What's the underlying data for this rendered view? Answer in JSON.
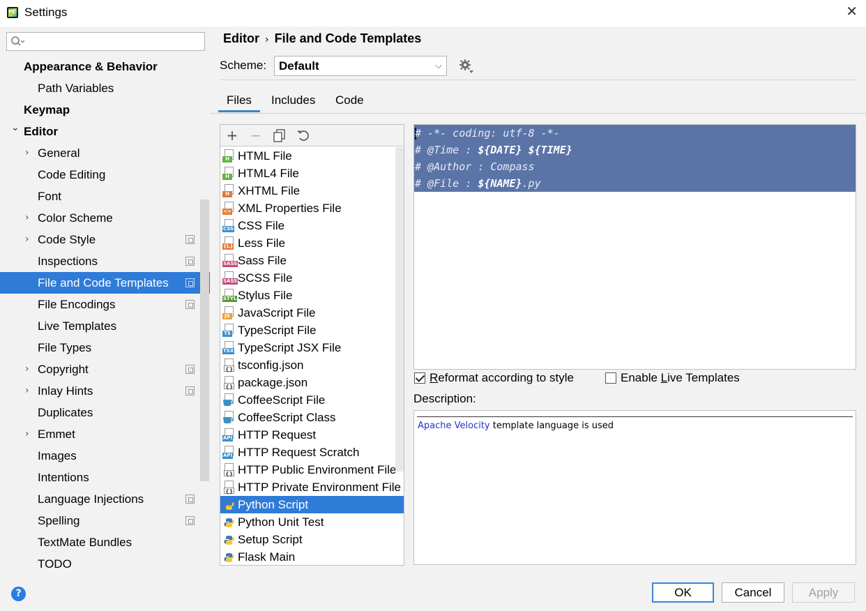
{
  "window": {
    "title": "Settings",
    "close_glyph": "✕"
  },
  "search": {
    "placeholder": "",
    "value": ""
  },
  "sidebar": {
    "items": [
      {
        "label": "Appearance & Behavior",
        "level": 0,
        "bold": true,
        "chevron": "none",
        "project_icon": false,
        "selected": false
      },
      {
        "label": "Path Variables",
        "level": 1,
        "bold": false,
        "chevron": "none",
        "project_icon": false,
        "selected": false
      },
      {
        "label": "Keymap",
        "level": 0,
        "bold": true,
        "chevron": "none",
        "project_icon": false,
        "selected": false
      },
      {
        "label": "Editor",
        "level": 0,
        "bold": true,
        "chevron": "expanded",
        "project_icon": false,
        "selected": false
      },
      {
        "label": "General",
        "level": 1,
        "bold": false,
        "chevron": "collapsed",
        "project_icon": false,
        "selected": false
      },
      {
        "label": "Code Editing",
        "level": 1,
        "bold": false,
        "chevron": "none",
        "project_icon": false,
        "selected": false
      },
      {
        "label": "Font",
        "level": 1,
        "bold": false,
        "chevron": "none",
        "project_icon": false,
        "selected": false
      },
      {
        "label": "Color Scheme",
        "level": 1,
        "bold": false,
        "chevron": "collapsed",
        "project_icon": false,
        "selected": false
      },
      {
        "label": "Code Style",
        "level": 1,
        "bold": false,
        "chevron": "collapsed",
        "project_icon": true,
        "selected": false
      },
      {
        "label": "Inspections",
        "level": 1,
        "bold": false,
        "chevron": "none",
        "project_icon": true,
        "selected": false
      },
      {
        "label": "File and Code Templates",
        "level": 1,
        "bold": false,
        "chevron": "none",
        "project_icon": true,
        "selected": true
      },
      {
        "label": "File Encodings",
        "level": 1,
        "bold": false,
        "chevron": "none",
        "project_icon": true,
        "selected": false
      },
      {
        "label": "Live Templates",
        "level": 1,
        "bold": false,
        "chevron": "none",
        "project_icon": false,
        "selected": false
      },
      {
        "label": "File Types",
        "level": 1,
        "bold": false,
        "chevron": "none",
        "project_icon": false,
        "selected": false
      },
      {
        "label": "Copyright",
        "level": 1,
        "bold": false,
        "chevron": "collapsed",
        "project_icon": true,
        "selected": false
      },
      {
        "label": "Inlay Hints",
        "level": 1,
        "bold": false,
        "chevron": "collapsed",
        "project_icon": true,
        "selected": false
      },
      {
        "label": "Duplicates",
        "level": 1,
        "bold": false,
        "chevron": "none",
        "project_icon": false,
        "selected": false
      },
      {
        "label": "Emmet",
        "level": 1,
        "bold": false,
        "chevron": "collapsed",
        "project_icon": false,
        "selected": false
      },
      {
        "label": "Images",
        "level": 1,
        "bold": false,
        "chevron": "none",
        "project_icon": false,
        "selected": false
      },
      {
        "label": "Intentions",
        "level": 1,
        "bold": false,
        "chevron": "none",
        "project_icon": false,
        "selected": false
      },
      {
        "label": "Language Injections",
        "level": 1,
        "bold": false,
        "chevron": "none",
        "project_icon": true,
        "selected": false
      },
      {
        "label": "Spelling",
        "level": 1,
        "bold": false,
        "chevron": "none",
        "project_icon": true,
        "selected": false
      },
      {
        "label": "TextMate Bundles",
        "level": 1,
        "bold": false,
        "chevron": "none",
        "project_icon": false,
        "selected": false
      },
      {
        "label": "TODO",
        "level": 1,
        "bold": false,
        "chevron": "none",
        "project_icon": false,
        "selected": false
      }
    ]
  },
  "breadcrumb": {
    "parent": "Editor",
    "separator": "›",
    "current": "File and Code Templates"
  },
  "scheme": {
    "label": "Scheme:",
    "value": "Default",
    "dropdown_glyph": "⌵"
  },
  "tabs": [
    {
      "label": "Files",
      "active": true
    },
    {
      "label": "Includes",
      "active": false
    },
    {
      "label": "Code",
      "active": false
    }
  ],
  "toolbar": {
    "add": "+",
    "remove": "−",
    "copy_icon": "copy-icon",
    "reset_icon": "reset-icon"
  },
  "templates": [
    {
      "label": "HTML File",
      "tag": "H",
      "tag_color": "#62b543",
      "kind": "page",
      "selected": false
    },
    {
      "label": "HTML4 File",
      "tag": "H",
      "tag_color": "#62b543",
      "kind": "page",
      "selected": false
    },
    {
      "label": "XHTML File",
      "tag": "H",
      "tag_color": "#e57a3c",
      "kind": "page",
      "selected": false
    },
    {
      "label": "XML Properties File",
      "tag": "<>",
      "tag_color": "#e57a3c",
      "kind": "page",
      "selected": false
    },
    {
      "label": "CSS File",
      "tag": "CSS",
      "tag_color": "#3d8fc6",
      "kind": "page",
      "selected": false
    },
    {
      "label": "Less File",
      "tag": "{L}",
      "tag_color": "#e57a3c",
      "kind": "page",
      "selected": false
    },
    {
      "label": "Sass File",
      "tag": "SASS",
      "tag_color": "#c44a7a",
      "kind": "page",
      "selected": false
    },
    {
      "label": "SCSS File",
      "tag": "SASS",
      "tag_color": "#c44a7a",
      "kind": "page",
      "selected": false
    },
    {
      "label": "Stylus File",
      "tag": "STYL",
      "tag_color": "#5a9a3a",
      "kind": "page",
      "selected": false
    },
    {
      "label": "JavaScript File",
      "tag": "JS",
      "tag_color": "#e8a33a",
      "kind": "page",
      "selected": false
    },
    {
      "label": "TypeScript File",
      "tag": "TS",
      "tag_color": "#3d8fc6",
      "kind": "page",
      "selected": false
    },
    {
      "label": "TypeScript JSX File",
      "tag": "TSX",
      "tag_color": "#3d8fc6",
      "kind": "page",
      "selected": false
    },
    {
      "label": "tsconfig.json",
      "tag": "{}",
      "tag_color": "#6e6e6e",
      "kind": "json",
      "selected": false
    },
    {
      "label": "package.json",
      "tag": "{}",
      "tag_color": "#6e6e6e",
      "kind": "json",
      "selected": false
    },
    {
      "label": "CoffeeScript File",
      "tag": "",
      "tag_color": "#3d8fc6",
      "kind": "coffee",
      "selected": false
    },
    {
      "label": "CoffeeScript Class",
      "tag": "",
      "tag_color": "#3d8fc6",
      "kind": "coffee",
      "selected": false
    },
    {
      "label": "HTTP Request",
      "tag": "API",
      "tag_color": "#3d8fc6",
      "kind": "page",
      "selected": false
    },
    {
      "label": "HTTP Request Scratch",
      "tag": "API",
      "tag_color": "#3d8fc6",
      "kind": "page",
      "selected": false
    },
    {
      "label": "HTTP Public Environment File",
      "tag": "{}",
      "tag_color": "#6e6e6e",
      "kind": "json",
      "selected": false
    },
    {
      "label": "HTTP Private Environment File",
      "tag": "{}",
      "tag_color": "#6e6e6e",
      "kind": "json",
      "selected": false
    },
    {
      "label": "Python Script",
      "tag": "",
      "tag_color": "#3d79b5",
      "kind": "python",
      "selected": true
    },
    {
      "label": "Python Unit Test",
      "tag": "",
      "tag_color": "#3d79b5",
      "kind": "python",
      "selected": false
    },
    {
      "label": "Setup Script",
      "tag": "",
      "tag_color": "#3d79b5",
      "kind": "python",
      "selected": false
    },
    {
      "label": "Flask Main",
      "tag": "",
      "tag_color": "#3d79b5",
      "kind": "python",
      "selected": false
    }
  ],
  "editor": {
    "lines": [
      [
        {
          "t": "# -*- coding: utf-8 -*-",
          "b": false
        }
      ],
      [
        {
          "t": "# @Time : ",
          "b": false
        },
        {
          "t": "${DATE}",
          "b": true
        },
        {
          "t": " ",
          "b": false
        },
        {
          "t": "${TIME}",
          "b": true
        }
      ],
      [
        {
          "t": "# @Author : Compass",
          "b": false
        }
      ],
      [
        {
          "t": "# @File : ",
          "b": false
        },
        {
          "t": "${NAME}",
          "b": true
        },
        {
          "t": ".py",
          "b": false
        }
      ]
    ]
  },
  "options": {
    "reformat": {
      "pre": "",
      "mnemonic": "R",
      "post": "eformat according to style",
      "checked": true
    },
    "live_templates": {
      "pre": "Enable ",
      "mnemonic": "L",
      "post": "ive Templates",
      "checked": false
    }
  },
  "description": {
    "label": "Description:",
    "link": "Apache Velocity",
    "text": " template language is used"
  },
  "buttons": {
    "ok": "OK",
    "cancel": "Cancel",
    "apply": "Apply",
    "help": "?"
  },
  "colors": {
    "selection": "#2f7bd8",
    "editor_selection": "#5b74a8",
    "link": "#2233cc",
    "tab_underline": "#4083c9"
  }
}
